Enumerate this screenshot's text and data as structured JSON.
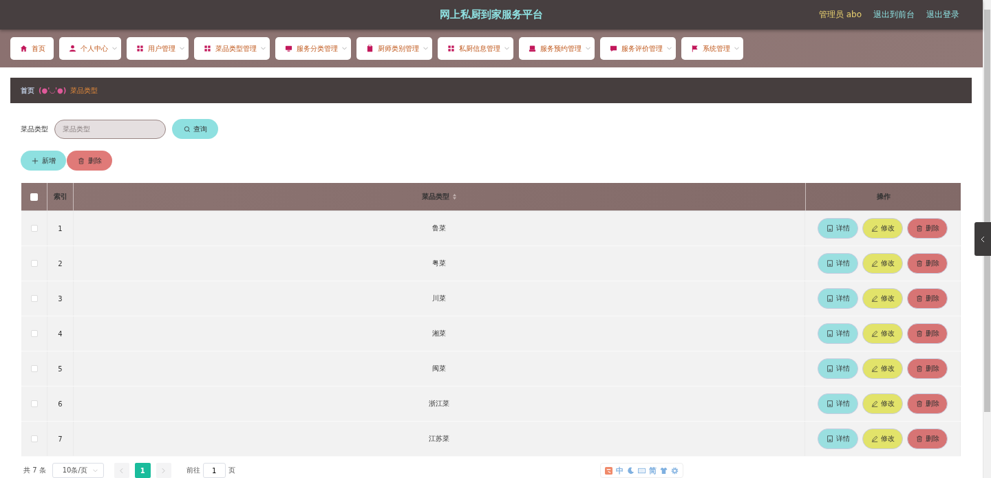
{
  "header": {
    "title": "网上私厨到家服务平台",
    "user": "管理员 abo",
    "links": [
      "退出到前台",
      "退出登录"
    ]
  },
  "nav": [
    {
      "label": "首页",
      "kind": "home",
      "dropdown": false
    },
    {
      "label": "个人中心",
      "kind": "user",
      "dropdown": true
    },
    {
      "label": "用户管理",
      "kind": "grid",
      "dropdown": true
    },
    {
      "label": "菜品类型管理",
      "kind": "grid",
      "dropdown": true
    },
    {
      "label": "服务分类管理",
      "kind": "monitor",
      "dropdown": true
    },
    {
      "label": "厨师类别管理",
      "kind": "clipboard",
      "dropdown": true
    },
    {
      "label": "私厨信息管理",
      "kind": "grid",
      "dropdown": true
    },
    {
      "label": "服务预约管理",
      "kind": "tray",
      "dropdown": true
    },
    {
      "label": "服务评价管理",
      "kind": "chat",
      "dropdown": true
    },
    {
      "label": "系统管理",
      "kind": "flag",
      "dropdown": true
    }
  ],
  "breadcrumb": {
    "home": "首页",
    "separator": "(●'◡'●)",
    "current": "菜品类型"
  },
  "search": {
    "label": "菜品类型",
    "placeholder": "菜品类型",
    "button": "查询"
  },
  "actions": [
    {
      "label": "新增",
      "kind": "add"
    },
    {
      "label": "删除",
      "kind": "delete"
    }
  ],
  "table": {
    "header_checked": false,
    "columns": [
      "索引",
      "菜品类型",
      "操作"
    ],
    "rows": [
      {
        "index": "1",
        "type": "鲁菜",
        "checked": false,
        "buttons": [
          {
            "label": "详情",
            "kind": "detail"
          },
          {
            "label": "修改",
            "kind": "edit"
          },
          {
            "label": "删除",
            "kind": "delete"
          }
        ]
      },
      {
        "index": "2",
        "type": "粤菜",
        "checked": false,
        "buttons": [
          {
            "label": "详情",
            "kind": "detail"
          },
          {
            "label": "修改",
            "kind": "edit"
          },
          {
            "label": "删除",
            "kind": "delete"
          }
        ]
      },
      {
        "index": "3",
        "type": "川菜",
        "checked": false,
        "buttons": [
          {
            "label": "详情",
            "kind": "detail"
          },
          {
            "label": "修改",
            "kind": "edit"
          },
          {
            "label": "删除",
            "kind": "delete"
          }
        ]
      },
      {
        "index": "4",
        "type": "湘菜",
        "checked": false,
        "buttons": [
          {
            "label": "详情",
            "kind": "detail"
          },
          {
            "label": "修改",
            "kind": "edit"
          },
          {
            "label": "删除",
            "kind": "delete"
          }
        ]
      },
      {
        "index": "5",
        "type": "闽菜",
        "checked": false,
        "buttons": [
          {
            "label": "详情",
            "kind": "detail"
          },
          {
            "label": "修改",
            "kind": "edit"
          },
          {
            "label": "删除",
            "kind": "delete"
          }
        ]
      },
      {
        "index": "6",
        "type": "浙江菜",
        "checked": false,
        "buttons": [
          {
            "label": "详情",
            "kind": "detail"
          },
          {
            "label": "修改",
            "kind": "edit"
          },
          {
            "label": "删除",
            "kind": "delete"
          }
        ]
      },
      {
        "index": "7",
        "type": "江苏菜",
        "checked": false,
        "buttons": [
          {
            "label": "详情",
            "kind": "detail"
          },
          {
            "label": "修改",
            "kind": "edit"
          },
          {
            "label": "删除",
            "kind": "delete"
          }
        ]
      }
    ]
  },
  "pagination": {
    "total": "共 7 条",
    "page_size": "10条/页",
    "pages": [
      {
        "label": "1",
        "selected": true
      }
    ],
    "goto_label": "前往",
    "goto_value": "1",
    "page_unit": "页"
  },
  "ime_toolbar": {
    "labels": [
      "中",
      "简"
    ]
  }
}
